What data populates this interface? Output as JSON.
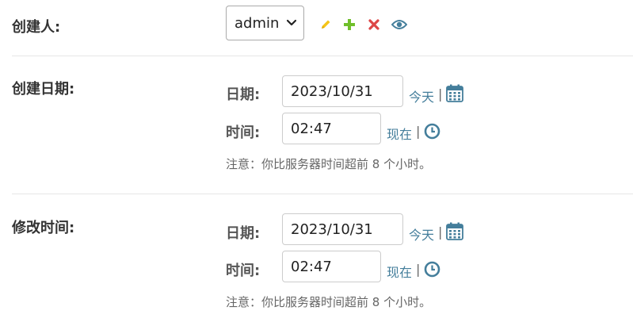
{
  "creator": {
    "label": "创建人:",
    "selected": "admin"
  },
  "created_date": {
    "label": "创建日期:",
    "date_label": "日期:",
    "date_value": "2023/10/31",
    "today_link": "今天",
    "separator": "|",
    "time_label": "时间:",
    "time_value": "02:47",
    "now_link": "现在",
    "note": "注意：你比服务器时间超前 8 个小时。"
  },
  "modified_time": {
    "label": "修改时间:",
    "date_label": "日期:",
    "date_value": "2023/10/31",
    "today_link": "今天",
    "separator": "|",
    "time_label": "时间:",
    "time_value": "02:47",
    "now_link": "现在",
    "note": "注意：你比服务器时间超前 8 个小时。"
  },
  "icons": {
    "edit": "pencil-icon",
    "add": "plus-icon",
    "delete": "close-icon",
    "view": "eye-icon",
    "calendar": "calendar-icon",
    "clock": "clock-icon"
  },
  "colors": {
    "link": "#447e9b",
    "edit": "#f5c518",
    "add": "#70bf2b",
    "delete": "#dd4646",
    "view": "#447e9b"
  }
}
